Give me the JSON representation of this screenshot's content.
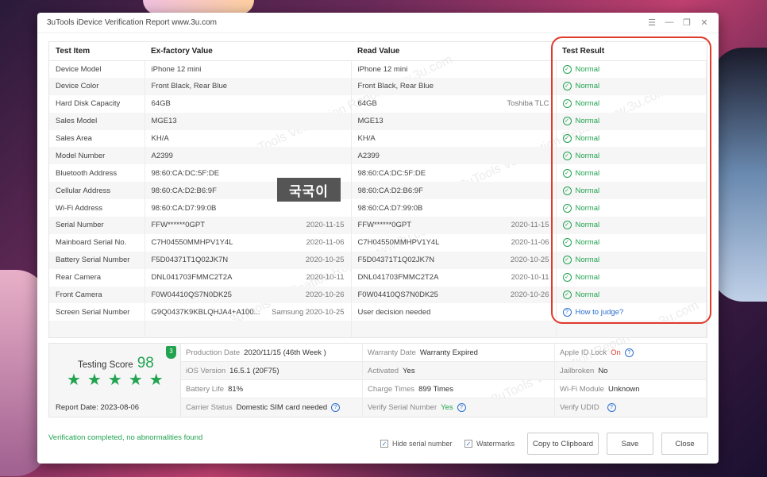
{
  "window": {
    "title": "3uTools iDevice Verification Report www.3u.com"
  },
  "table": {
    "headers": [
      "Test Item",
      "Ex-factory Value",
      "Read Value",
      "Test Result"
    ],
    "rows": [
      {
        "item": "Device Model",
        "factory": "iPhone 12 mini",
        "factory_note": "",
        "read": "iPhone 12 mini",
        "read_note": "",
        "result": "Normal"
      },
      {
        "item": "Device Color",
        "factory": "Front Black, Rear Blue",
        "factory_note": "",
        "read": "Front Black, Rear Blue",
        "read_note": "",
        "result": "Normal"
      },
      {
        "item": "Hard Disk Capacity",
        "factory": "64GB",
        "factory_note": "",
        "read": "64GB",
        "read_note": "Toshiba TLC",
        "result": "Normal"
      },
      {
        "item": "Sales Model",
        "factory": "MGE13",
        "factory_note": "",
        "read": "MGE13",
        "read_note": "",
        "result": "Normal"
      },
      {
        "item": "Sales Area",
        "factory": "KH/A",
        "factory_note": "",
        "read": "KH/A",
        "read_note": "",
        "result": "Normal"
      },
      {
        "item": "Model Number",
        "factory": "A2399",
        "factory_note": "",
        "read": "A2399",
        "read_note": "",
        "result": "Normal"
      },
      {
        "item": "Bluetooth Address",
        "factory": "98:60:CA:DC:5F:DE",
        "factory_note": "",
        "read": "98:60:CA:DC:5F:DE",
        "read_note": "",
        "result": "Normal"
      },
      {
        "item": "Cellular Address",
        "factory": "98:60:CA:D2:B6:9F",
        "factory_note": "",
        "read": "98:60:CA:D2:B6:9F",
        "read_note": "",
        "result": "Normal"
      },
      {
        "item": "Wi-Fi Address",
        "factory": "98:60:CA:D7:99:0B",
        "factory_note": "",
        "read": "98:60:CA:D7:99:0B",
        "read_note": "",
        "result": "Normal"
      },
      {
        "item": "Serial Number",
        "factory": "FFW******0GPT",
        "factory_note": "2020-11-15",
        "read": "FFW******0GPT",
        "read_note": "2020-11-15",
        "result": "Normal"
      },
      {
        "item": "Mainboard Serial No.",
        "factory": "C7H04550MMHPV1Y4L",
        "factory_note": "2020-11-06",
        "read": "C7H04550MMHPV1Y4L",
        "read_note": "2020-11-06",
        "result": "Normal"
      },
      {
        "item": "Battery Serial Number",
        "factory": "F5D04371T1Q02JK7N",
        "factory_note": "2020-10-25",
        "read": "F5D04371T1Q02JK7N",
        "read_note": "2020-10-25",
        "result": "Normal"
      },
      {
        "item": "Rear Camera",
        "factory": "DNL041703FMMC2T2A",
        "factory_note": "2020-10-11",
        "read": "DNL041703FMMC2T2A",
        "read_note": "2020-10-11",
        "result": "Normal"
      },
      {
        "item": "Front Camera",
        "factory": "F0W04410QS7N0DK25",
        "factory_note": "2020-10-26",
        "read": "F0W04410QS7N0DK25",
        "read_note": "2020-10-26",
        "result": "Normal"
      },
      {
        "item": "Screen Serial Number",
        "factory": "G9Q0437K9KBLQHJA4+A100...",
        "factory_note": "Samsung 2020-10-25",
        "read": "User decision needed",
        "read_note": "",
        "result": "How to judge?"
      }
    ]
  },
  "overlay_label": "국국이",
  "score": {
    "title": "Testing Score",
    "value": "98",
    "badge": "3",
    "stars": 5,
    "report_date": "Report Date: 2023-08-06"
  },
  "info": [
    {
      "label": "Production Date",
      "value": "2020/11/15 (46th Week )"
    },
    {
      "label": "Warranty Date",
      "value": "Warranty Expired"
    },
    {
      "label": "Apple ID Lock",
      "value": "On"
    },
    {
      "label": "iOS Version",
      "value": "16.5.1 (20F75)"
    },
    {
      "label": "Activated",
      "value": "Yes"
    },
    {
      "label": "Jailbroken",
      "value": "No"
    },
    {
      "label": "Battery Life",
      "value": "81%"
    },
    {
      "label": "Charge Times",
      "value": "899 Times"
    },
    {
      "label": "Wi-Fi Module",
      "value": "Unknown"
    },
    {
      "label": "Carrier Status",
      "value": "Domestic SIM card needed"
    },
    {
      "label": "Verify Serial Number",
      "value": "Yes"
    },
    {
      "label": "Verify UDID",
      "value": ""
    }
  ],
  "footer": {
    "status": "Verification completed, no abnormalities found",
    "hide_serial": "Hide serial number",
    "watermarks": "Watermarks",
    "copy": "Copy to Clipboard",
    "save": "Save",
    "close": "Close"
  },
  "watermark_text": "3uTools Verification Report www.3u.com"
}
